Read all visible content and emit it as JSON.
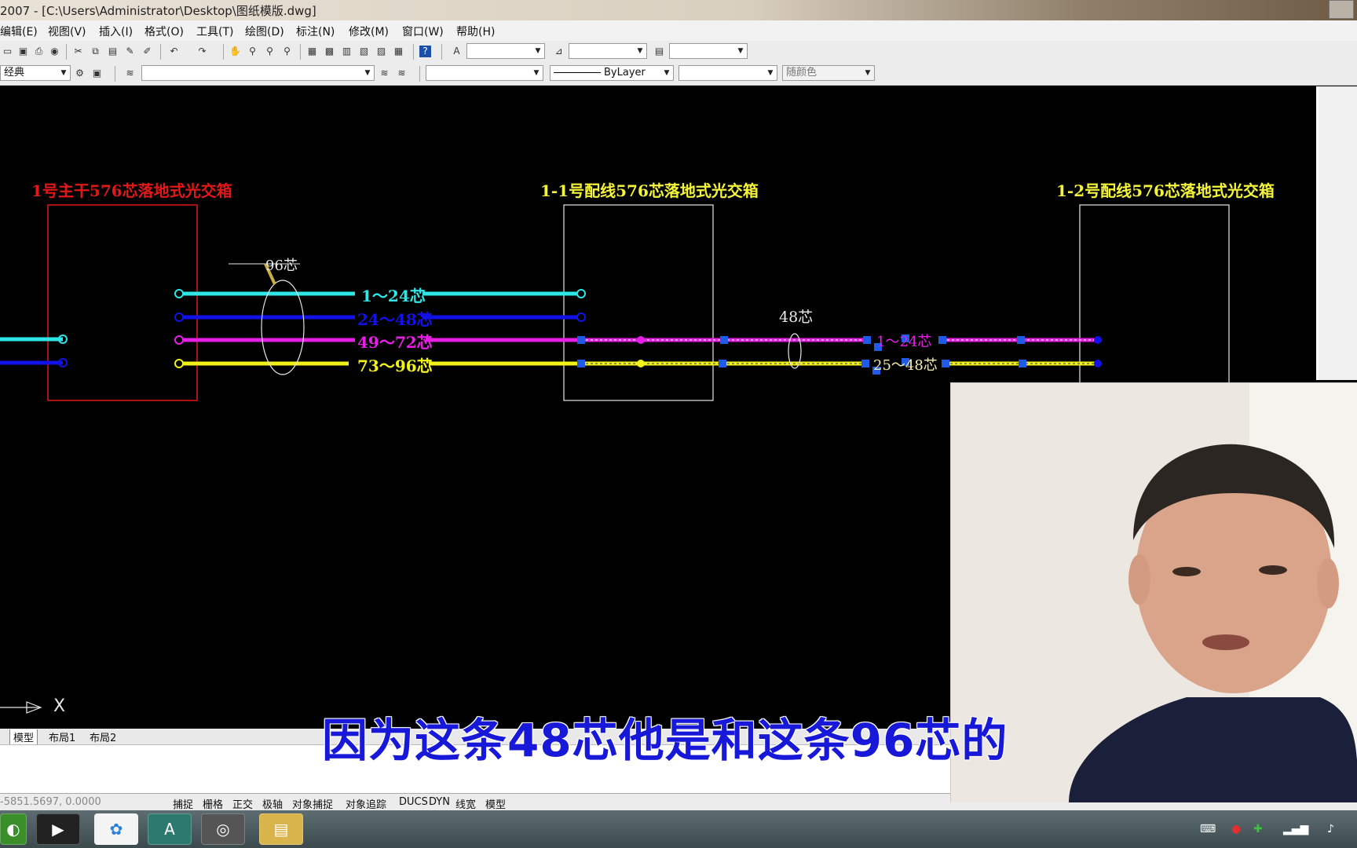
{
  "titlebar": {
    "title": "2007 - [C:\\Users\\Administrator\\Desktop\\图纸模版.dwg]"
  },
  "menu": [
    "编辑(E)",
    "视图(V)",
    "插入(I)",
    "格式(O)",
    "工具(T)",
    "绘图(D)",
    "标注(N)",
    "修改(M)",
    "窗口(W)",
    "帮助(H)"
  ],
  "toolbar2": {
    "workspace": "经典",
    "linetype": "ByLayer",
    "color": "随颜色"
  },
  "drawing": {
    "box1_title": "1号主干576芯落地式光交箱",
    "box2_title": "1-1号配线576芯落地式光交箱",
    "box3_title": "1-2号配线576芯落地式光交箱",
    "cable96": "96芯",
    "cable48": "48芯",
    "lines": [
      "1～24芯",
      "24～48芯",
      "49～72芯",
      "73～96芯"
    ],
    "sub1": "1～24芯",
    "sub2": "25～48芯",
    "axis_x": "X",
    "colors": {
      "cyan": "#2fe6e6",
      "blue": "#1212e8",
      "magenta": "#e61ee6",
      "yellow": "#f2f21a",
      "red": "#e01818",
      "title_yellow": "#f4f43a"
    }
  },
  "tabs": [
    "模型",
    "布局1",
    "布局2"
  ],
  "status": {
    "coords": "-5851.5697,  0.0000",
    "buttons": [
      "捕捉",
      "栅格",
      "正交",
      "极轴",
      "对象捕捉",
      "对象追踪",
      "DUCS",
      "DYN",
      "线宽",
      "模型"
    ]
  },
  "subtitle": "因为这条48芯他是和这条96芯的",
  "taskbar": {
    "apps": [
      "360",
      "camera",
      "baidu",
      "autocad",
      "pro",
      "folder"
    ]
  }
}
